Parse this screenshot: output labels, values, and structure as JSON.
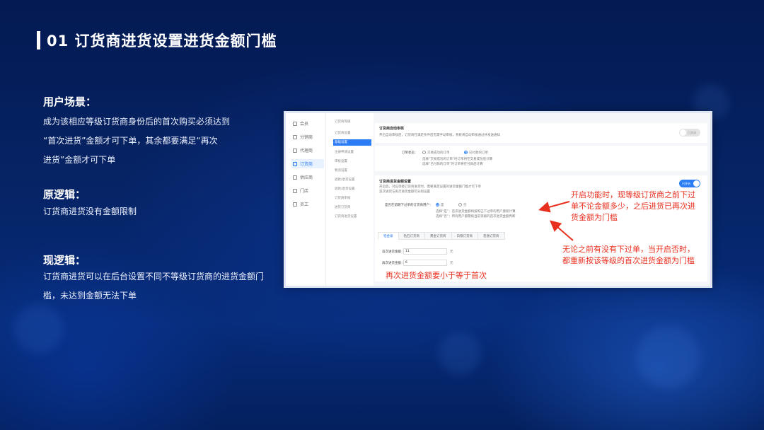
{
  "title": "01 订货商进货设置进货金额门槛",
  "sections": {
    "scenario_head": "用户场景：",
    "scenario_lines": [
      "成为该相应等级订货商身份后的首次购买必须达到",
      "“首次进货”金额才可下单，其余都要满足“再次",
      "进货”金额才可下单"
    ],
    "old_head": "原逻辑：",
    "old_lines": [
      "订货商进货没有金额限制"
    ],
    "new_head": "现逻辑：",
    "new_lines": [
      "订货商进货可以在后台设置不同不等级订货商的进货金额门",
      "槛，未达到金额无法下单"
    ]
  },
  "screenshot": {
    "nav1": [
      "会员",
      "分销商",
      "代理商",
      "订货商",
      "供应商",
      "门店",
      "员工"
    ],
    "nav2": [
      "订货商等级",
      "订货商设置",
      "基础设置",
      "注册申请设置",
      "审核设置",
      "物流设置",
      "退款/退货设置",
      "退款/退货设置",
      "订货商审核",
      "进货订货商",
      "订货商进货设置"
    ],
    "card1_title": "订货商自动审核",
    "card1_desc": "开启自动审核后，订货商在满足条件后无需手动审核，系统将自动审核通过并发送通知",
    "card1_toggle": "已关闭",
    "order_label": "订单状态：",
    "order_opt1": "交易成功的订单",
    "order_opt2": "已付款的订单",
    "order_note1": "选择“交易成功的订单”时订单将在交易成功后计算",
    "order_note2": "选择“已付款的订单”时订单将在付款后计算",
    "card2_title": "订货商进货金额设置",
    "card2_desc1": "开启后，对应等级订货商进货时，需要满足设置的进货金额门槛才可下单",
    "card2_desc2": "首次进货与再次进货金额可分别设置",
    "card2_toggle": "已开启",
    "question": "是否在前期下过单的订货商用户：",
    "yes": "是",
    "no": "否",
    "q_note1": "选择“是”：首次进货金额将按照已下过单的用户重新计算",
    "q_note2": "选择“否”：所有用户都需按当前等级的首次进货金额判断",
    "tabs": [
      "铂金级",
      "钻石订货商",
      "黄金订货商",
      "白银订货商",
      "普通订货商"
    ],
    "first_label": "首次进货金额：",
    "first_value": "11",
    "again_label": "再次进货金额：",
    "again_value": "6",
    "unit": "元"
  },
  "annotations": {
    "a1": [
      "开启功能时，现等级订货商之前下过",
      "单不论金额多少，之后进货已再次进",
      "货金额为门槛"
    ],
    "a2": [
      "无论之前有没有下过单，当开启否时，",
      "都重新按该等级的首次进货金额为门槛"
    ],
    "a3": "再次进货金额要小于等于首次"
  },
  "colors": {
    "accent": "#2b7cf5",
    "annotation": "#e8301f"
  }
}
